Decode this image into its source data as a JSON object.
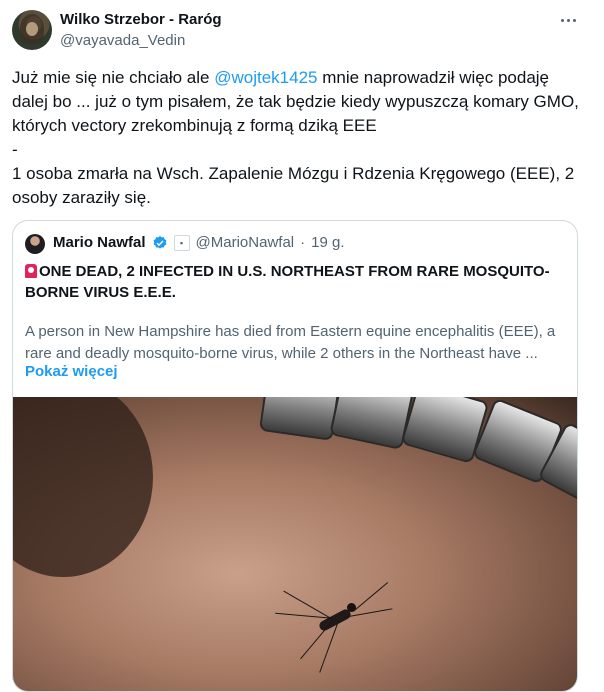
{
  "author": {
    "name": "Wilko Strzebor - Raróg",
    "handle": "@vayavada_Vedin"
  },
  "tweet": {
    "text_before_mention": "Już mie się nie chciało ale ",
    "mention": "@wojtek1425",
    "text_after_mention": " mnie naprowadził więc podaję dalej bo ... już o tym pisałem, że tak będzie kiedy wypuszczą komary GMO, których vectory zrekombinują z formą dziką EEE\n-\n1 osoba zmarła na Wsch. Zapalenie Mózgu i Rdzenia Kręgowego (EEE), 2 osoby zaraziły się."
  },
  "quoted": {
    "name": "Mario Nawfal",
    "handle": "@MarioNawfal",
    "separator": "·",
    "time": "19 g.",
    "headline": "ONE DEAD, 2 INFECTED IN U.S. NORTHEAST FROM RARE MOSQUITO-BORNE VIRUS E.E.E.",
    "text": "A person in New Hampshire has died from Eastern equine encephalitis (EEE), a rare and deadly mosquito-borne virus, while 2 others in the Northeast have ...",
    "show_more": "Pokaż więcej"
  },
  "icons": {
    "more": "more-horizontal-icon",
    "verified": "verified-badge-icon",
    "siren": "siren-emoji-icon"
  },
  "colors": {
    "accent": "#1d9bf0",
    "text": "#0f1419",
    "secondary": "#536471",
    "border": "#cfd9de"
  }
}
